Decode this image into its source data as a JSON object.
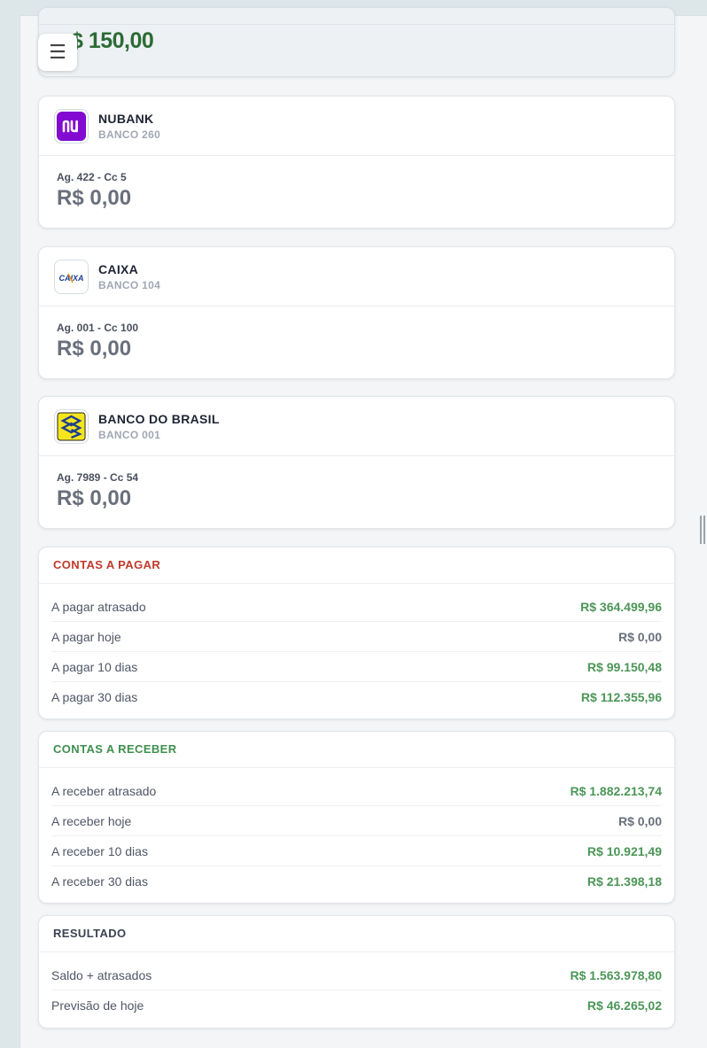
{
  "top": {
    "amount": "$ 150,00"
  },
  "menu": {
    "icon": "☰"
  },
  "banks": [
    {
      "name": "NUBANK",
      "code": "BANCO 260",
      "agency": "Ag. 422 - Cc 5",
      "balance": "R$ 0,00",
      "logo_text": "nu",
      "logo_color": "#820ad1"
    },
    {
      "name": "CAIXA",
      "code": "BANCO 104",
      "agency": "Ag. 001 - Cc 100",
      "balance": "R$ 0,00",
      "logo_text": "CAIXA",
      "logo_color": "#1c3f94"
    },
    {
      "name": "BANCO DO BRASIL",
      "code": "BANCO 001",
      "agency": "Ag. 7989 - Cc 54",
      "balance": "R$ 0,00",
      "logo_text": "",
      "logo_color": "#f6e51d"
    }
  ],
  "pagar": {
    "title": "CONTAS A PAGAR",
    "rows": [
      {
        "label": "A pagar atrasado",
        "value": "R$ 364.499,96"
      },
      {
        "label": "A pagar hoje",
        "value": "R$ 0,00"
      },
      {
        "label": "A pagar 10 dias",
        "value": "R$ 99.150,48"
      },
      {
        "label": "A pagar 30 dias",
        "value": "R$ 112.355,96"
      }
    ]
  },
  "receber": {
    "title": "CONTAS A RECEBER",
    "rows": [
      {
        "label": "A receber atrasado",
        "value": "R$ 1.882.213,74"
      },
      {
        "label": "A receber hoje",
        "value": "R$ 0,00"
      },
      {
        "label": "A receber 10 dias",
        "value": "R$ 10.921,49"
      },
      {
        "label": "A receber 30 dias",
        "value": "R$ 21.398,18"
      }
    ]
  },
  "resultado": {
    "title": "RESULTADO",
    "rows": [
      {
        "label": "Saldo + atrasados",
        "value": "R$ 1.563.978,80"
      },
      {
        "label": "Previsão de hoje",
        "value": "R$ 46.265,02"
      }
    ]
  },
  "colors": {
    "positive": "#4c9657",
    "neutral": "#6a6f7c",
    "pagar_title": "#c0392b",
    "receber_title": "#3f8f4e"
  }
}
